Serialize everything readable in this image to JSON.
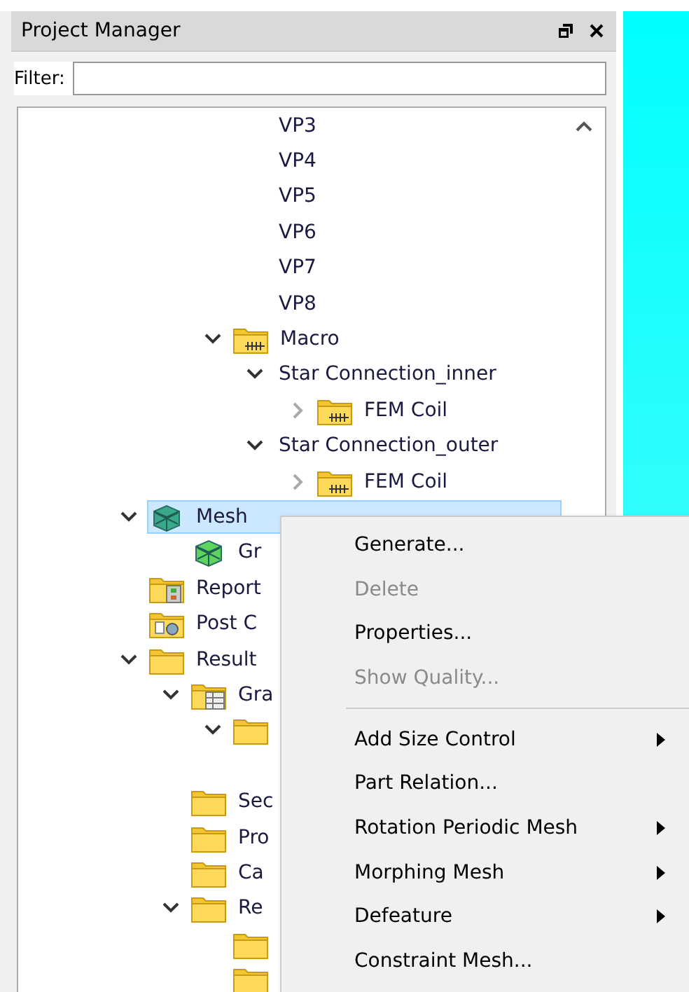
{
  "panel": {
    "title": "Project Manager"
  },
  "filter": {
    "label": "Filter:"
  },
  "tree": [
    {
      "children": [
        {
          "children": [
            {
              "children": [
                {
                  "label": "VP3"
                },
                {
                  "label": "VP4"
                },
                {
                  "label": "VP5"
                },
                {
                  "label": "VP6"
                },
                {
                  "label": "VP7"
                },
                {
                  "label": "VP8"
                }
              ]
            },
            {
              "label": "Macro",
              "kind": "macro-folder",
              "expanded": true,
              "children": [
                {
                  "label": "Star Connection_inner",
                  "expanded": true,
                  "children": [
                    {
                      "label": "FEM Coil",
                      "kind": "macro-folder",
                      "expanded": false
                    }
                  ]
                },
                {
                  "label": "Star Connection_outer",
                  "expanded": true,
                  "children": [
                    {
                      "label": "FEM Coil",
                      "kind": "macro-folder",
                      "expanded": false
                    }
                  ]
                }
              ]
            }
          ]
        }
      ]
    },
    {
      "label": "Mesh",
      "kind": "mesh",
      "expanded": true,
      "selected": true,
      "children": [
        {
          "label": "Gr",
          "kind": "mesh-green",
          "selected": false
        }
      ]
    },
    {
      "label": "Report",
      "kind": "report",
      "selected": false
    },
    {
      "label": "Post C",
      "kind": "post",
      "selected": false
    },
    {
      "label": "Result",
      "kind": "folder",
      "expanded": true,
      "selected": false,
      "children": [
        {
          "label": "Gra",
          "kind": "table-folder",
          "expanded": true,
          "selected": false,
          "children": [
            {
              "kind": "folder",
              "expanded": true,
              "selected": false
            }
          ]
        },
        {
          "label": "Sec",
          "kind": "folder",
          "selected": false
        },
        {
          "label": "Pro",
          "kind": "folder",
          "selected": false
        },
        {
          "label": "Ca",
          "kind": "folder",
          "selected": false
        },
        {
          "label": "Re",
          "kind": "folder",
          "expanded": true,
          "selected": false,
          "children": [
            {
              "kind": "folder",
              "selected": false
            },
            {
              "kind": "folder",
              "selected": false
            }
          ]
        }
      ]
    }
  ],
  "context_menu": [
    {
      "kind": "item",
      "label": "Generate...",
      "disabled": false,
      "submenu": false
    },
    {
      "kind": "item",
      "label": "Delete",
      "disabled": true,
      "submenu": false
    },
    {
      "kind": "item",
      "label": "Properties...",
      "disabled": false,
      "submenu": false
    },
    {
      "kind": "item",
      "label": "Show Quality...",
      "disabled": true,
      "submenu": false
    },
    {
      "kind": "separator"
    },
    {
      "kind": "item",
      "label": "Add Size Control",
      "disabled": false,
      "submenu": true
    },
    {
      "kind": "item",
      "label": "Part Relation...",
      "disabled": false,
      "submenu": false
    },
    {
      "kind": "item",
      "label": "Rotation Periodic Mesh",
      "disabled": false,
      "submenu": true
    },
    {
      "kind": "item",
      "label": "Morphing Mesh",
      "disabled": false,
      "submenu": true
    },
    {
      "kind": "item",
      "label": "Defeature",
      "disabled": false,
      "submenu": true
    },
    {
      "kind": "item",
      "label": "Constraint Mesh...",
      "disabled": false,
      "submenu": false
    }
  ]
}
